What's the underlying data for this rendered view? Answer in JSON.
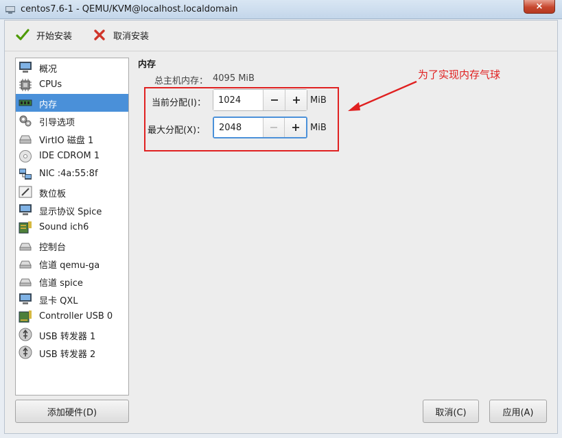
{
  "window": {
    "title": "centos7.6-1 - QEMU/KVM@localhost.localdomain",
    "close_glyph": "×"
  },
  "toolbar": {
    "begin_install": "开始安装",
    "cancel_install": "取消安装"
  },
  "sidebar": {
    "items": [
      {
        "label": "概况",
        "icon": "monitor-icon"
      },
      {
        "label": "CPUs",
        "icon": "cpu-icon"
      },
      {
        "label": "内存",
        "icon": "memory-icon"
      },
      {
        "label": "引导选项",
        "icon": "gears-icon"
      },
      {
        "label": "VirtIO 磁盘 1",
        "icon": "disk-icon"
      },
      {
        "label": "IDE CDROM 1",
        "icon": "cdrom-icon"
      },
      {
        "label": "NIC :4a:55:8f",
        "icon": "network-icon"
      },
      {
        "label": "数位板",
        "icon": "tablet-icon"
      },
      {
        "label": "显示协议 Spice",
        "icon": "display-icon"
      },
      {
        "label": "Sound ich6",
        "icon": "sound-icon"
      },
      {
        "label": "控制台",
        "icon": "serial-icon"
      },
      {
        "label": "信道 qemu-ga",
        "icon": "channel-icon"
      },
      {
        "label": "信道 spice",
        "icon": "channel-icon"
      },
      {
        "label": "显卡 QXL",
        "icon": "video-icon"
      },
      {
        "label": "Controller USB 0",
        "icon": "controller-icon"
      },
      {
        "label": "USB 转发器 1",
        "icon": "usb-icon"
      },
      {
        "label": "USB 转发器 2",
        "icon": "usb-icon"
      }
    ],
    "active_index": 2,
    "add_hardware": "添加硬件(D)"
  },
  "memory": {
    "section_title": "内存",
    "total_label": "总主机内存：",
    "total_value": "4095 MiB",
    "current_label": "当前分配(I)：",
    "current_value": "1024",
    "max_label": "最大分配(X)：",
    "max_value": "2048",
    "unit": "MiB"
  },
  "annotation": {
    "text": "为了实现内存气球",
    "color": "#e02020"
  },
  "footer": {
    "cancel": "取消(C)",
    "apply": "应用(A)"
  },
  "colors": {
    "selection": "#4a90d9",
    "focus": "#4a90d9"
  }
}
